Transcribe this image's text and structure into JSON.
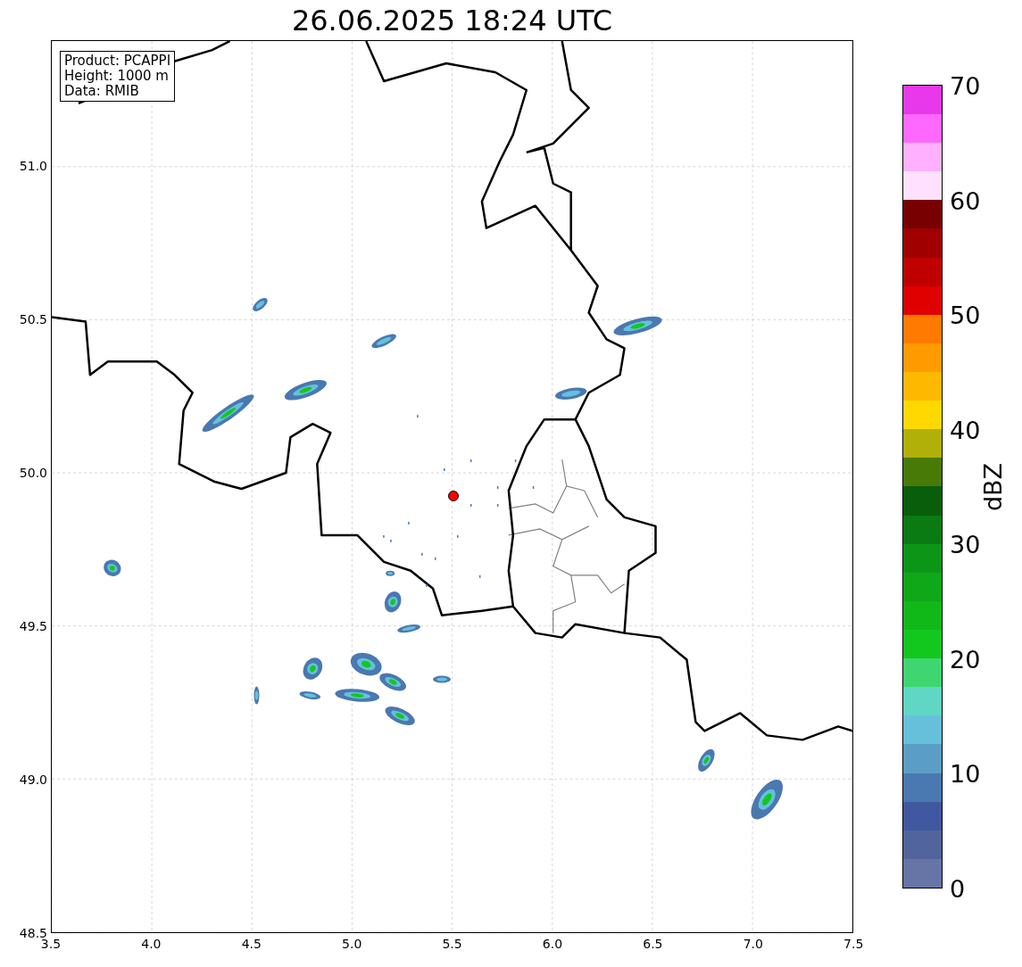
{
  "title": "26.06.2025 18:24 UTC",
  "info_box": [
    "Product: PCAPPI",
    "Height: 1000 m",
    "Data: RMIB"
  ],
  "map": {
    "xticks": [
      "3.5",
      "4.0",
      "4.5",
      "5.0",
      "5.5",
      "6.0",
      "6.5",
      "7.0",
      "7.5"
    ],
    "yticks": [
      "51.0",
      "50.5",
      "50.0",
      "49.5",
      "49.0",
      "48.5"
    ]
  },
  "colorbar": {
    "label": "dBZ",
    "ticks": [
      "70",
      "60",
      "50",
      "40",
      "30",
      "20",
      "10",
      "0"
    ],
    "bins": [
      {
        "color": "#6674a6"
      },
      {
        "color": "#52649c"
      },
      {
        "color": "#4058a0"
      },
      {
        "color": "#4a78b0"
      },
      {
        "color": "#5a9ec6"
      },
      {
        "color": "#66c0dc"
      },
      {
        "color": "#60d6c4"
      },
      {
        "color": "#3ed670"
      },
      {
        "color": "#12c81e"
      },
      {
        "color": "#10b818"
      },
      {
        "color": "#0ea818"
      },
      {
        "color": "#0c9618"
      },
      {
        "color": "#0a7a12"
      },
      {
        "color": "#085e0a"
      },
      {
        "color": "#487a08"
      },
      {
        "color": "#b0b008"
      },
      {
        "color": "#ffd800"
      },
      {
        "color": "#ffb800"
      },
      {
        "color": "#ff9a00"
      },
      {
        "color": "#ff7a00"
      },
      {
        "color": "#e00000"
      },
      {
        "color": "#c00000"
      },
      {
        "color": "#a00000"
      },
      {
        "color": "#780000"
      },
      {
        "color": "#ffe0ff"
      },
      {
        "color": "#ffb0ff"
      },
      {
        "color": "#ff68ff"
      },
      {
        "color": "#e838ec"
      }
    ]
  }
}
